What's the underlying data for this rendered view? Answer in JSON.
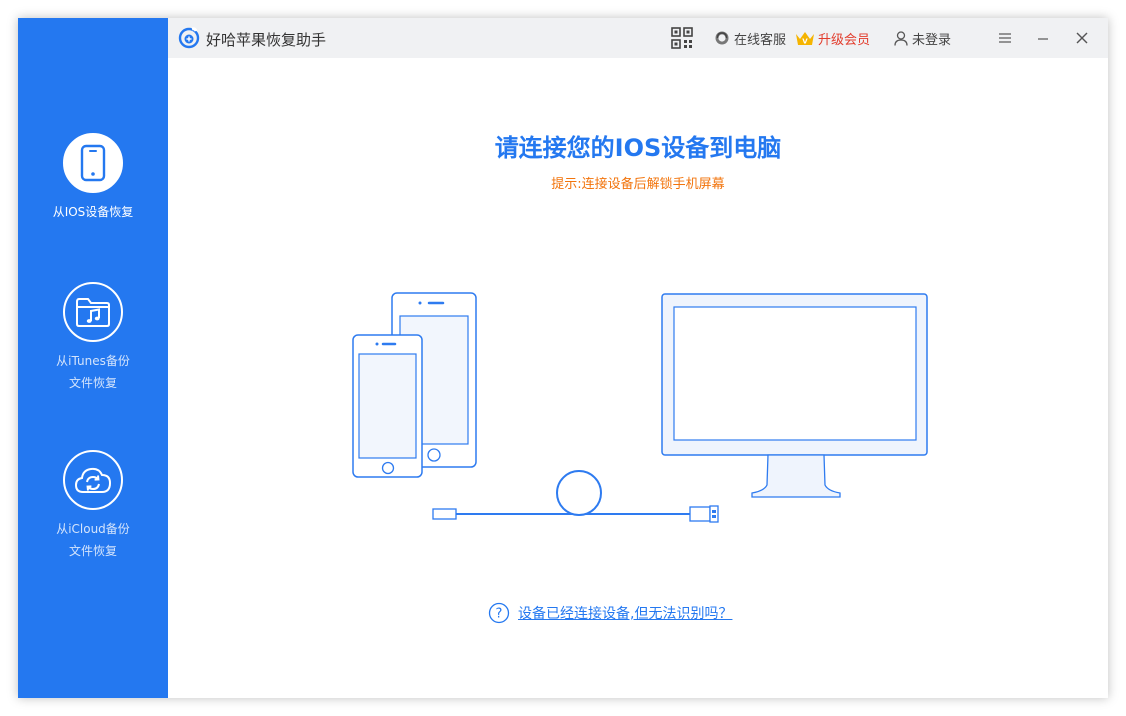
{
  "app": {
    "title": "好哈苹果恢复助手"
  },
  "toolbar": {
    "service": "在线客服",
    "upgrade": "升级会员",
    "login": "未登录"
  },
  "sidebar": {
    "items": [
      {
        "label": "从IOS设备恢复",
        "icon": "phone-icon",
        "active": true
      },
      {
        "label_line1": "从iTunes备份",
        "label_line2": "文件恢复",
        "icon": "music-folder-icon"
      },
      {
        "label_line1": "从iCloud备份",
        "label_line2": "文件恢复",
        "icon": "cloud-sync-icon"
      }
    ]
  },
  "main": {
    "title": "请连接您的IOS设备到电脑",
    "hint": "提示:连接设备后解锁手机屏幕",
    "help_link": "设备已经连接设备,但无法识别吗？"
  },
  "colors": {
    "accent": "#2478f0",
    "hint": "#f2740c",
    "upgrade": "#e23c2c",
    "crown": "#f5b400"
  }
}
